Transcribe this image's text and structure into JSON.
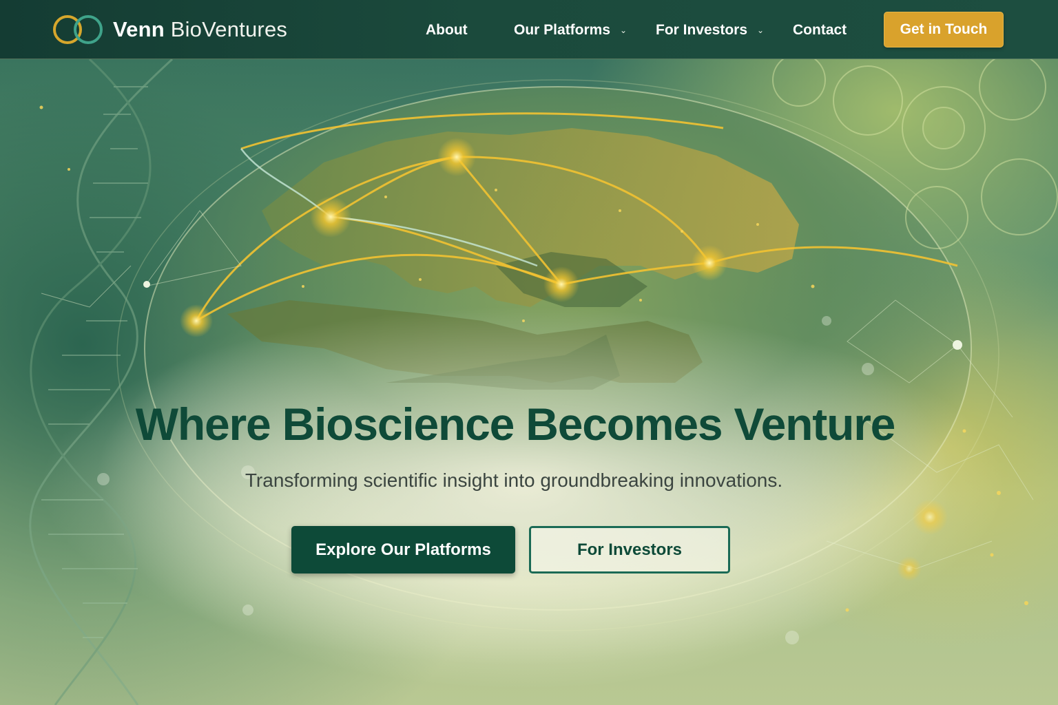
{
  "brand": {
    "name_bold": "Venn",
    "name_light": "BioVentures",
    "logo_icon": "venn-rings-icon",
    "colors": {
      "primary": "#0d4a38",
      "accent": "#d9a22c",
      "nav_bg": "#173f35"
    }
  },
  "nav": {
    "items": [
      {
        "label": "About",
        "has_dropdown": false
      },
      {
        "label": "Our Platforms",
        "has_dropdown": true
      },
      {
        "label": "For Investors",
        "has_dropdown": true
      },
      {
        "label": "Contact",
        "has_dropdown": false
      }
    ],
    "cta_label": "Get in Touch",
    "dropdown_glyph": "⌄"
  },
  "hero": {
    "headline": "Where Bioscience Becomes Venture",
    "subheadline": "Transforming scientific insight into groundbreaking innovations.",
    "primary_button": "Explore Our Platforms",
    "secondary_button": "For Investors",
    "background_motifs": [
      "globe-network-icon",
      "dna-helix-icon",
      "cell-pattern-icon"
    ]
  }
}
